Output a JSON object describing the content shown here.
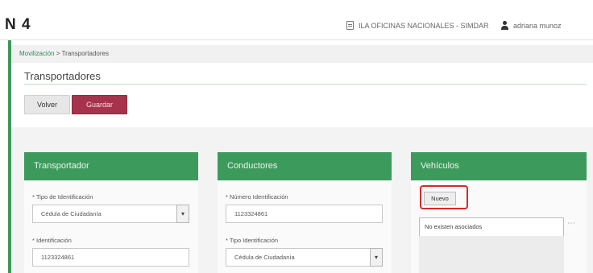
{
  "header": {
    "brand": "N 4",
    "office": "ILA OFICINAS NACIONALES - SIMDAR",
    "user": "adriana munoz"
  },
  "breadcrumb": {
    "link": "Movilización",
    "separator": " > ",
    "current": "Transportadores"
  },
  "page": {
    "title": "Transportadores"
  },
  "actions": {
    "back_label": "Volver",
    "save_label": "Guardar"
  },
  "transportador": {
    "title": "Transportador",
    "id_type_label": "* Tipo de Identificación",
    "id_type_value": "Cédula de Ciudadanía",
    "id_label": "* Identificación",
    "id_value": "1123324861"
  },
  "conductores": {
    "title": "Conductores",
    "id_number_label": "* Número Identificación",
    "id_number_value": "1123324861",
    "id_type_label": "* Tipo Identificación",
    "id_type_value": "Cédula de Ciudadanía"
  },
  "vehiculos": {
    "title": "Vehículos",
    "new_label": "Nuevo",
    "empty_text": "No existen asociados"
  },
  "icons": {
    "office": "building-icon",
    "user": "user-icon",
    "select": "chevron-down-icon"
  },
  "colors": {
    "accent_green": "#3d9a5d",
    "save_button": "#a6324b",
    "highlight": "#d62b2b"
  }
}
